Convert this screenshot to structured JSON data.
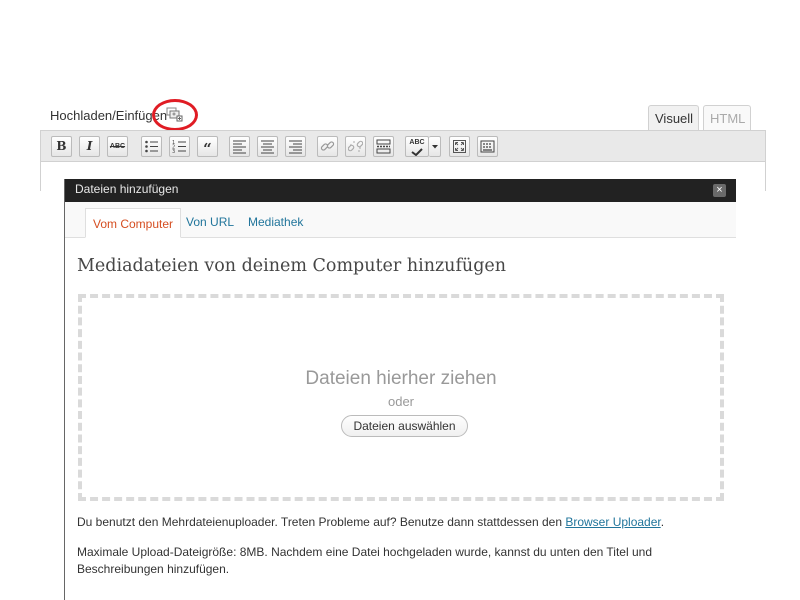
{
  "editor": {
    "upload_label": "Hochladen/Einfügen",
    "media_icon": "add-media-icon",
    "highlight_color": "#e01c24",
    "tabs": {
      "visual": "Visuell",
      "html": "HTML"
    },
    "toolbar": {
      "bold": "B",
      "italic": "I",
      "strikethrough": "ABC",
      "blockquote": "“",
      "spellcheck": "ABC"
    }
  },
  "modal": {
    "title": "Dateien hinzufügen",
    "close": "×",
    "tabs": [
      "Vom Computer",
      "Von URL",
      "Mediathek"
    ],
    "active_tab": "Vom Computer",
    "heading": "Mediadateien von deinem Computer hinzufügen",
    "dropzone": {
      "title": "Dateien hierher ziehen",
      "or": "oder",
      "button": "Dateien auswählen"
    },
    "note1_prefix": "Du benutzt den Mehrdateienuploader. Treten Probleme auf? Benutze dann stattdessen den ",
    "note1_link": "Browser Uploader",
    "note1_suffix": ".",
    "note2": "Maximale Upload-Dateigröße: 8MB. Nachdem eine Datei hochgeladen wurde, kannst du unten den Titel und Beschreibungen hinzufügen."
  }
}
